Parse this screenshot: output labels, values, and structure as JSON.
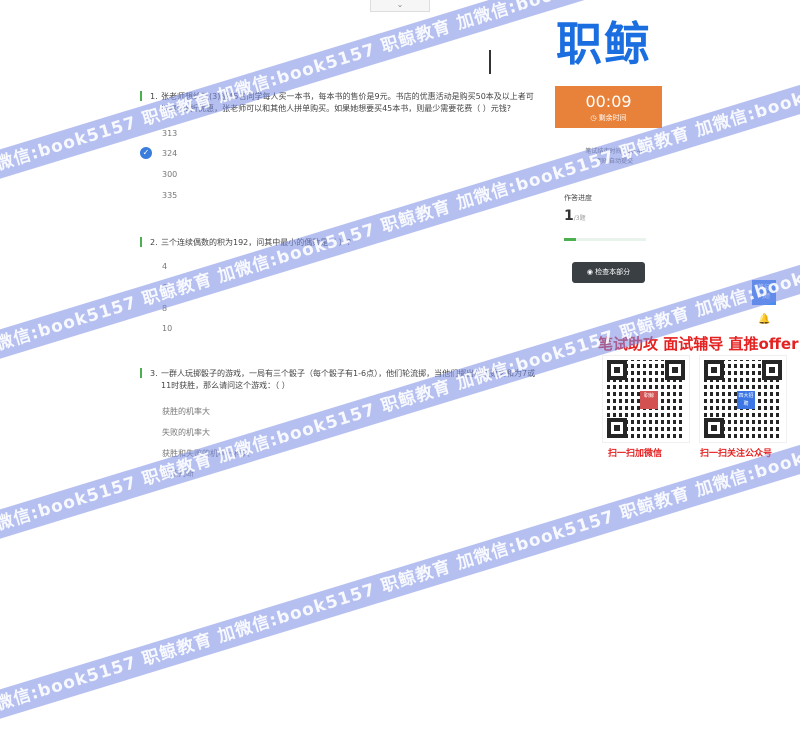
{
  "top_tab": "⌄",
  "brand": {
    "logo": "职鲸"
  },
  "questions": [
    {
      "num": "1.",
      "text": "张老师想给五(3)班45名同学每人买一本书，每本书的售价是9元。书店的优惠活动是购买50本及以上者可以享受8折优惠，张老师可以和其他人拼单购买。如果她想要买45本书，则最少需要花费（ ）元钱?",
      "options": [
        "313",
        "324",
        "300",
        "335"
      ],
      "selected": 1
    },
    {
      "num": "2.",
      "text": "三个连续偶数的积为192，问其中最小的偶数是（ ）?",
      "options": [
        "4",
        "6",
        "8",
        "10"
      ]
    },
    {
      "num": "3.",
      "text": "一群人玩掷骰子的游戏，一局有三个骰子（每个骰子有1-6点），他们轮流掷，当他们掷出的点数之和为7或11时获胜，那么请问这个游戏：（ ）",
      "options": [
        "获胜的机率大",
        "失败的机率大",
        "获胜和失败的机率一样大",
        "无法判断"
      ]
    }
  ],
  "timer": {
    "time": "00:09",
    "label": "剩余时间"
  },
  "info": {
    "end_label": "笔试结束时间：",
    "end_time": "10:40",
    "auto": "到时自动提交"
  },
  "progress": {
    "label": "作答进度",
    "current": "1",
    "total": "/3题",
    "fraction": 0.15
  },
  "check_button": "检查本部分",
  "side_button": "笔记\n问题",
  "ad": {
    "headline": "笔试助攻  面试辅导  直推offer",
    "qr1_caption": "扫一扫加微信",
    "qr2_caption": "扫一扫关注公众号",
    "qr1_center": "职鲸",
    "qr2_center": "四大招聘"
  },
  "watermark": "职鲸教育 加微信:book5157",
  "colors": {
    "accent": "#e8823a",
    "green": "#4caf50",
    "blue": "#1a6ee0",
    "red": "#e52222"
  }
}
